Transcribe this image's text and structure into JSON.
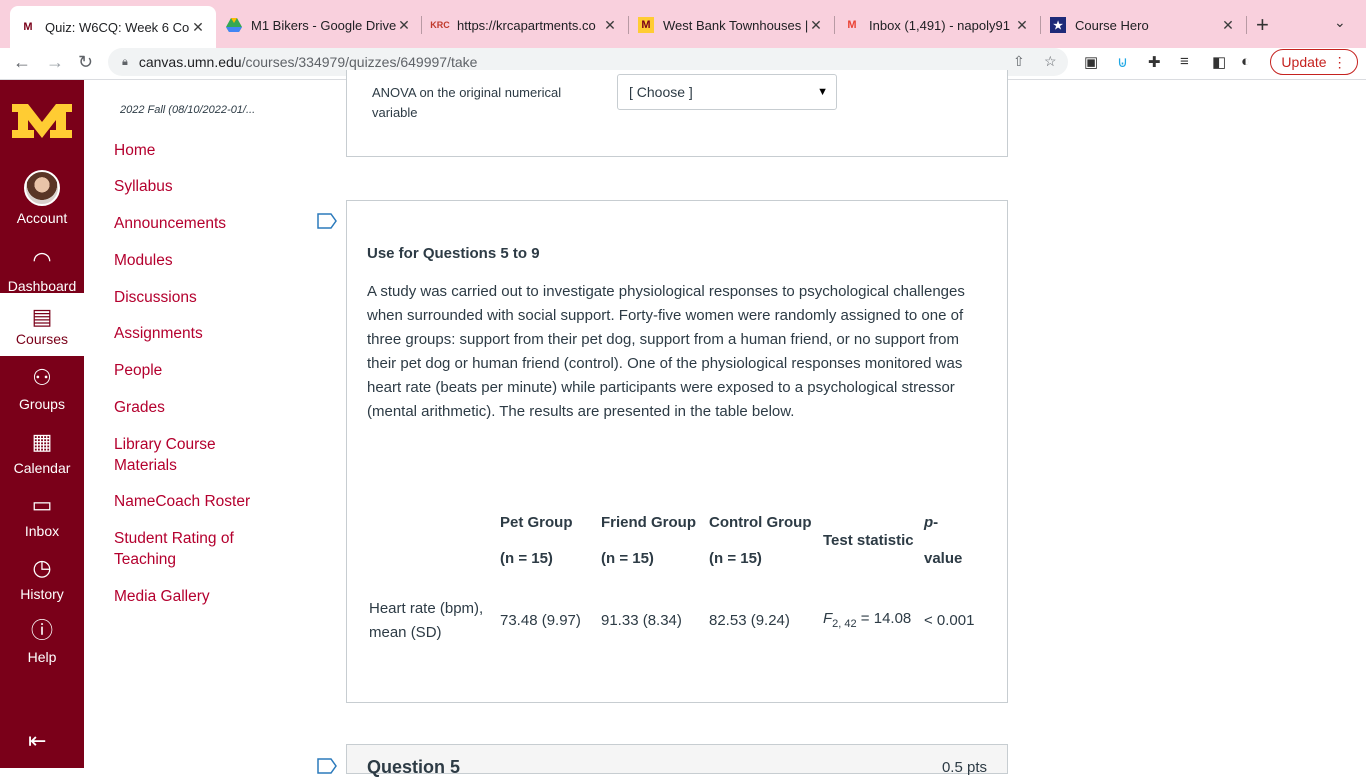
{
  "browser": {
    "tabs": [
      {
        "title": "Quiz: W6CQ: Week 6 Co",
        "icon": "umn-logo-icon"
      },
      {
        "title": "M1 Bikers - Google Drive",
        "icon": "google-drive-icon"
      },
      {
        "title": "https://krcapartments.co",
        "icon": "krc-icon"
      },
      {
        "title": "West Bank Townhouses |",
        "icon": "umn-logo-icon"
      },
      {
        "title": "Inbox (1,491) - napoly91",
        "icon": "gmail-icon"
      },
      {
        "title": "Course Hero",
        "icon": "course-hero-icon"
      }
    ],
    "url_host": "canvas.umn.edu",
    "url_path": "/courses/334979/quizzes/649997/take",
    "update_label": "Update"
  },
  "global_nav": {
    "items": [
      {
        "label": "Account",
        "icon": "avatar"
      },
      {
        "label": "Dashboard",
        "icon": "dashboard-icon"
      },
      {
        "label": "Courses",
        "icon": "courses-icon"
      },
      {
        "label": "Groups",
        "icon": "groups-icon"
      },
      {
        "label": "Calendar",
        "icon": "calendar-icon"
      },
      {
        "label": "Inbox",
        "icon": "inbox-icon"
      },
      {
        "label": "History",
        "icon": "history-icon"
      },
      {
        "label": "Help",
        "icon": "help-icon"
      }
    ]
  },
  "course_nav": {
    "term": "2022 Fall (08/10/2022-01/...",
    "links": [
      "Home",
      "Syllabus",
      "Announcements",
      "Modules",
      "Discussions",
      "Assignments",
      "People",
      "Grades",
      "Library Course Materials",
      "NameCoach Roster",
      "Student Rating of Teaching",
      "Media Gallery"
    ]
  },
  "prev_question": {
    "row_label": "ANOVA on the original numerical variable",
    "select_value": "[ Choose ]"
  },
  "intro": {
    "heading": "Use for Questions 5 to 9",
    "paragraph": "A study was carried out to investigate physiological responses to psychological challenges when surrounded with social support. Forty-five women were randomly assigned to one of three groups: support from their pet dog, support from a human friend, or no support from their pet dog or human friend (control). One of the physiological responses monitored was heart rate (beats per minute) while participants were exposed to a psychological stressor (mental arithmetic). The results are presented in the table below."
  },
  "results_table": {
    "headers": [
      {
        "name": "Pet Group",
        "n": "(n = 15)"
      },
      {
        "name": "Friend Group",
        "n": "(n = 15)"
      },
      {
        "name": "Control Group",
        "n": "(n = 15)"
      }
    ],
    "test_statistic_header": "Test statistic",
    "pvalue_header_italic": "p",
    "pvalue_header_rest": "-value",
    "row_label": "Heart rate (bpm), mean (SD)",
    "cells": [
      "73.48 (9.97)",
      "91.33 (8.34)",
      "82.53 (9.24)"
    ],
    "stat_letter": "F",
    "stat_sub": "2, 42",
    "stat_value": " = 14.08",
    "pvalue": "< 0.001"
  },
  "next_question": {
    "title": "Question 5",
    "points": "0.5 pts"
  }
}
